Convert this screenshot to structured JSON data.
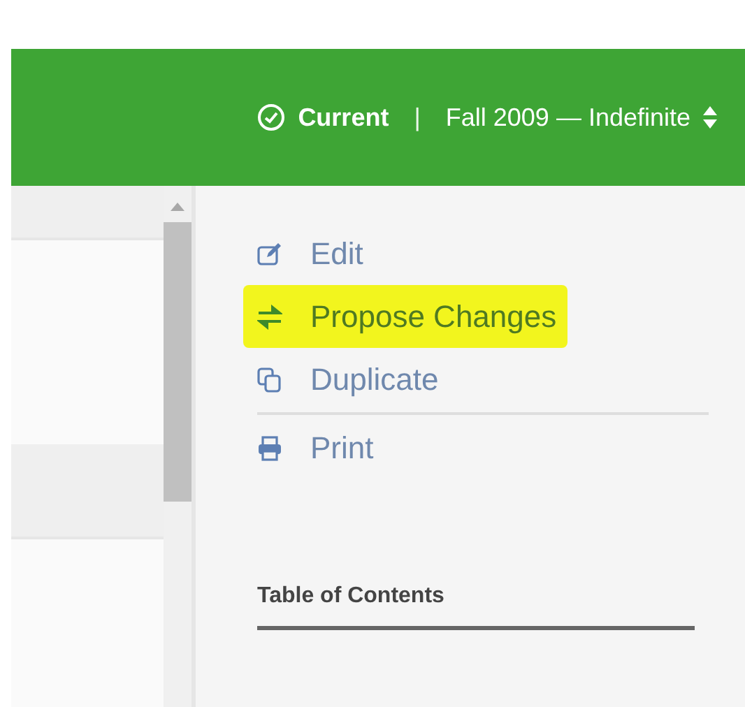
{
  "header": {
    "status": {
      "label": "Current"
    },
    "divider": "|",
    "term": {
      "label": "Fall 2009 — Indefinite"
    }
  },
  "action_groups": [
    [
      {
        "kind": "edit",
        "label": "Edit",
        "highlighted": false
      },
      {
        "kind": "propose",
        "label": "Propose Changes",
        "highlighted": true
      },
      {
        "kind": "duplicate",
        "label": "Duplicate",
        "highlighted": false
      }
    ],
    [
      {
        "kind": "print",
        "label": "Print",
        "highlighted": false
      }
    ]
  ],
  "toc": {
    "heading": "Table of Contents"
  }
}
